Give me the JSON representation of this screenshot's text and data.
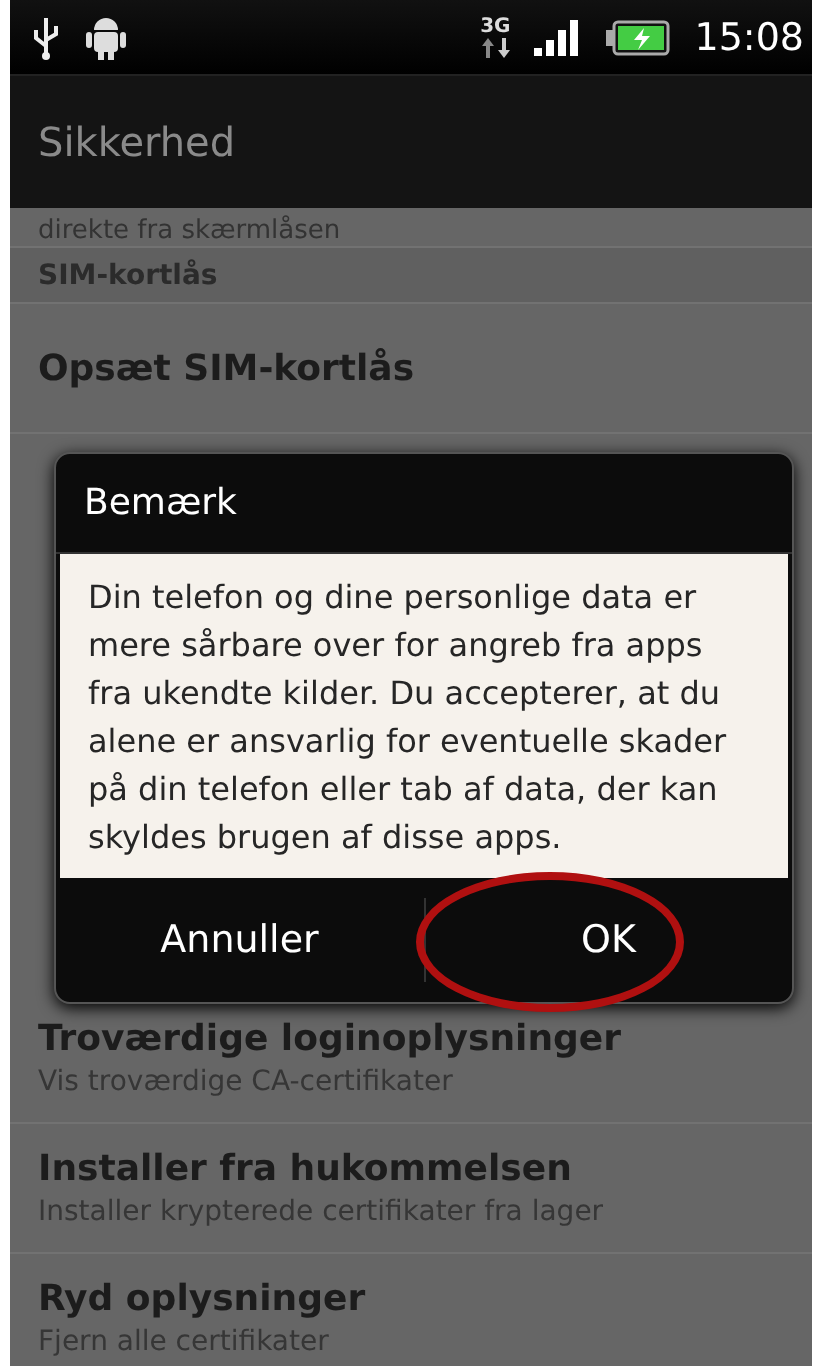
{
  "status_bar": {
    "network": "3G",
    "time": "15:08"
  },
  "app_bar": {
    "title": "Sikkerhed"
  },
  "list_top": [
    {
      "kind": "summary",
      "text": "direkte fra skærmlåsen"
    },
    {
      "kind": "header",
      "text": "SIM-kortlås"
    },
    {
      "kind": "item",
      "title": "Opsæt SIM-kortlås"
    }
  ],
  "dialog": {
    "title": "Bemærk",
    "message": "Din telefon og dine personlige data er mere sårbare over for angreb fra apps fra ukendte kilder. Du accepterer, at du alene er ansvarlig for eventuelle skader på din telefon eller tab af data, der kan skyldes brugen af disse apps.",
    "buttons": [
      {
        "label": "Annuller",
        "highlighted": false
      },
      {
        "label": "OK",
        "highlighted": true
      }
    ]
  },
  "list_bottom": [
    {
      "kind": "item",
      "title": "Troværdige loginoplysninger",
      "summary": "Vis troværdige CA-certifikater"
    },
    {
      "kind": "item",
      "title": "Installer fra hukommelsen",
      "summary": "Installer krypterede certifikater fra lager"
    },
    {
      "kind": "item",
      "title": "Ryd oplysninger",
      "summary": "Fjern alle certifikater"
    }
  ]
}
